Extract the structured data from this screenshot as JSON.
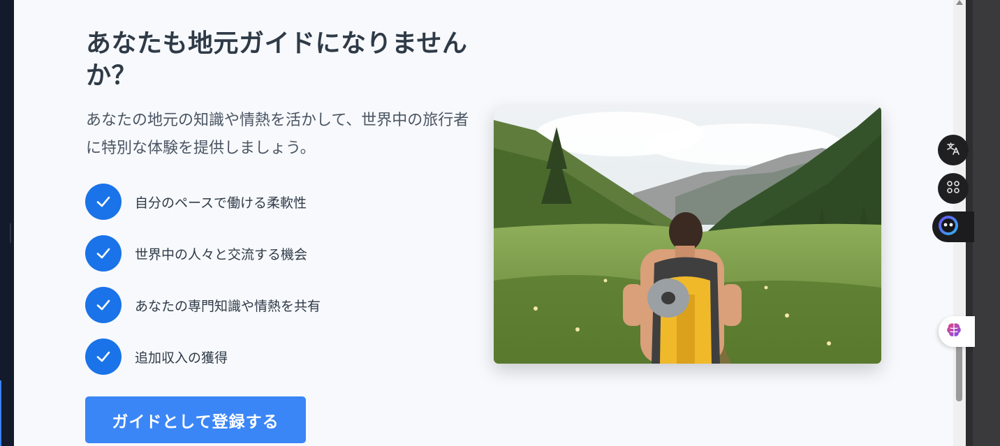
{
  "guide_section": {
    "title": "あなたも地元ガイドになりませんか？",
    "intro": "あなたの地元の知識や情熱を活かして、世界中の旅行者に特別な体験を提供しましょう。",
    "benefits": [
      "自分のペースで働ける柔軟性",
      "世界中の人々と交流する機会",
      "あなたの専門知識や情熱を共有",
      "追加収入の獲得"
    ],
    "cta_label": "ガイドとして登録する"
  },
  "colors": {
    "check_circle": "#1a73e8",
    "cta_button": "#3b86f7",
    "title_text": "#2f3a47",
    "page_background": "#f7f9fc"
  },
  "icons": {
    "benefit_check": "checkmark-icon",
    "translate": "translate-icon",
    "apps": "apps-grid-icon",
    "assistant": "assistant-face-icon",
    "brain": "brain-icon"
  }
}
